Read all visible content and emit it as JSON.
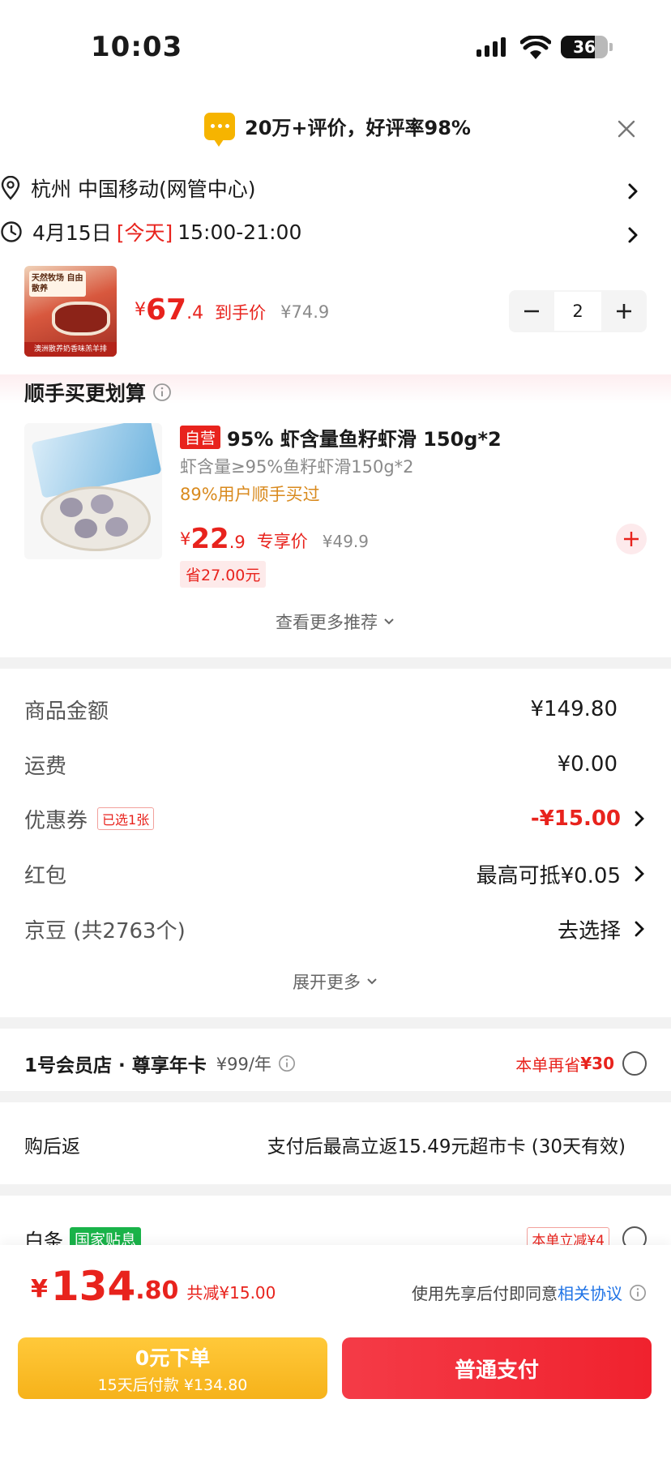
{
  "status_bar": {
    "time": "10:03",
    "battery": "36"
  },
  "banner": {
    "text": "20万+评价，好评率98%"
  },
  "address": {
    "text": "杭州 中国移动(网管中心)"
  },
  "delivery": {
    "date": "4月15日",
    "today": "[今天]",
    "window": "15:00-21:00"
  },
  "main_product": {
    "image_text_top": "天然牧场 自由散养",
    "image_text_bottom": "澳洲散养奶香味羔羊排",
    "currency": "¥",
    "price_int": "67",
    "price_dec": ".4",
    "price_label": "到手价",
    "original_price": "¥74.9",
    "quantity": "2"
  },
  "recommend": {
    "title": "顺手买更划算",
    "item": {
      "tag": "自营",
      "name": "95% 虾含量鱼籽虾滑 150g*2",
      "spec": "虾含量≥95%鱼籽虾滑150g*2",
      "bought": "89%用户顺手买过",
      "currency": "¥",
      "price_int": "22",
      "price_dec": ".9",
      "price_label": "专享价",
      "original_price": "¥49.9",
      "save": "省27.00元"
    },
    "more": "查看更多推荐"
  },
  "fees": {
    "goods_label": "商品金额",
    "goods_value": "¥149.80",
    "shipping_label": "运费",
    "shipping_value": "¥0.00",
    "coupon_label": "优惠券",
    "coupon_badge": "已选1张",
    "coupon_value": "-¥15.00",
    "redpacket_label": "红包",
    "redpacket_value": "最高可抵¥0.05",
    "beans_label": "京豆 (共2763个)",
    "beans_value": "去选择",
    "expand": "展开更多"
  },
  "membership": {
    "title": "1号会员店 · 尊享年卡",
    "price": "¥99/年",
    "save": "本单再省",
    "save_amount": "¥30"
  },
  "cashback": {
    "label": "购后返",
    "text": "支付后最高立返15.49元超市卡 (30天有效)"
  },
  "baitiao": {
    "label": "白条",
    "badge": "国家贴息",
    "discount": "本单立减¥4"
  },
  "bottom": {
    "currency": "¥",
    "total_int": "134",
    "total_dec": ".80",
    "reduced": "共减¥15.00",
    "agreement_prefix": "使用先享后付即同意",
    "agreement_link": "相关协议",
    "btn_zero_title": "0元下单",
    "btn_zero_sub": "15天后付款 ¥134.80",
    "btn_pay": "普通支付"
  },
  "colors": {
    "accent_red": "#e8231d",
    "button_yellow": "#fbc02d",
    "button_red": "#f5222d",
    "badge_green": "#19b349"
  }
}
